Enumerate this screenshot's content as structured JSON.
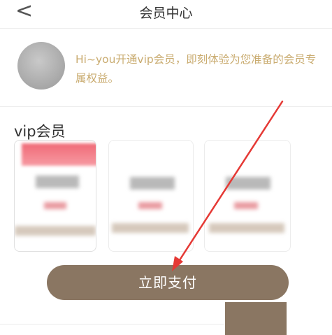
{
  "header": {
    "title": "会员中心",
    "back_icon": "chevron-left-icon"
  },
  "profile": {
    "avatar": "avatar",
    "promo_text": "Hi~you开通vip会员，即刻体验为您准备的会员专属权益。",
    "promo_color": "#c9ab6f"
  },
  "vip": {
    "section_title": "vip会员",
    "plans": [
      {
        "selected": true,
        "badge_color": "#f06b77"
      },
      {
        "selected": false
      },
      {
        "selected": false
      }
    ]
  },
  "pay_button": {
    "label": "立即支付",
    "color": "#8a7662"
  },
  "annotation": {
    "type": "red-arrow",
    "color": "#e53935"
  }
}
